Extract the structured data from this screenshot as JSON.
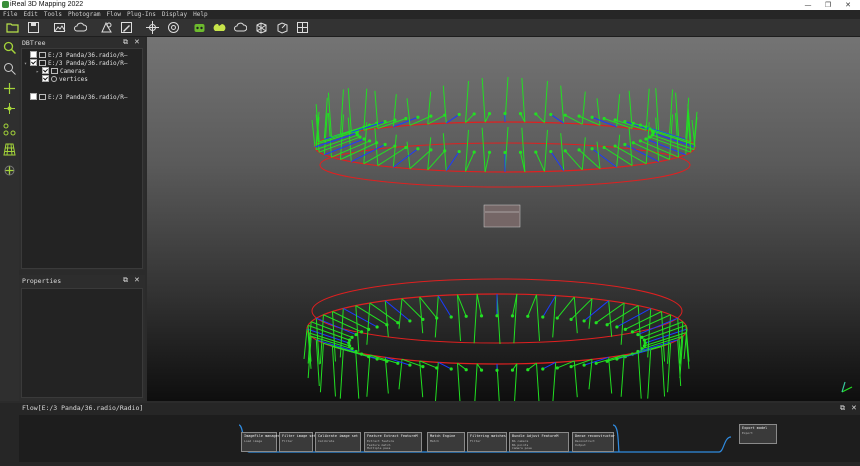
{
  "window": {
    "title": "iReal 3D Mapping 2022",
    "controls": {
      "minimize": "—",
      "maximize": "❐",
      "close": "✕"
    }
  },
  "menu": [
    "File",
    "Edit",
    "Tools",
    "Photogram",
    "Flow",
    "Plug-Ins",
    "Display",
    "Help"
  ],
  "toolbar": {
    "items": [
      "open-folder-icon",
      "save-icon",
      "image-icon",
      "cloud-icon",
      "photogram-icon",
      "edit-icon",
      "target-icon",
      "crosshair-icon",
      "robot-icon",
      "pointcloud-icon",
      "cloud-icon",
      "mesh-icon",
      "mesh-export-icon",
      "texture-icon"
    ]
  },
  "left_tools": [
    "zoom-icon",
    "zoom-fit-icon",
    "move-icon",
    "pivot-icon",
    "graph-icon",
    "grid-icon",
    "add-point-icon"
  ],
  "dbtree": {
    "title": "DBTree",
    "items": [
      {
        "label": "E:/3 Panda/36.radio/R—",
        "checked": false,
        "depth": 0
      },
      {
        "label": "E:/3 Panda/36.radio/R—",
        "checked": true,
        "depth": 0,
        "expanded": true
      },
      {
        "label": "Cameras",
        "checked": true,
        "depth": 1
      },
      {
        "label": "vertices",
        "checked": true,
        "depth": 1
      },
      {
        "label": "E:/3 Panda/36.radio/R—",
        "checked": false,
        "depth": 0
      }
    ]
  },
  "properties": {
    "title": "Properties"
  },
  "flow": {
    "title": "Flow[E:/3 Panda/36.radio/Radio]",
    "nodes": [
      {
        "title": "ImageFile manager",
        "rows": [
          "Load image"
        ]
      },
      {
        "title": "Filter image set",
        "rows": [
          "Filter"
        ]
      },
      {
        "title": "Calibrate image set",
        "rows": [
          "Calibrate"
        ]
      },
      {
        "title": "Feature Extract FeatureM",
        "rows": [
          "Extract feature",
          "Feature match",
          "Multiple pass"
        ]
      },
      {
        "title": "Match Engine",
        "rows": [
          "Match"
        ]
      },
      {
        "title": "Filtering matches",
        "rows": [
          "Filter"
        ]
      },
      {
        "title": "Bundle Adjust FeatureM",
        "rows": [
          "BA camera",
          "BA points",
          "Camera pose"
        ]
      },
      {
        "title": "Dense reconstructor",
        "rows": [
          "Reconstruct",
          "Output"
        ]
      },
      {
        "title": "Export model",
        "rows": [
          "Export"
        ]
      }
    ]
  },
  "colors": {
    "ring": "#e02020",
    "camera_frame": "#22e022",
    "camera_axis": "#1a3cff",
    "accent": "#39c9a0"
  }
}
